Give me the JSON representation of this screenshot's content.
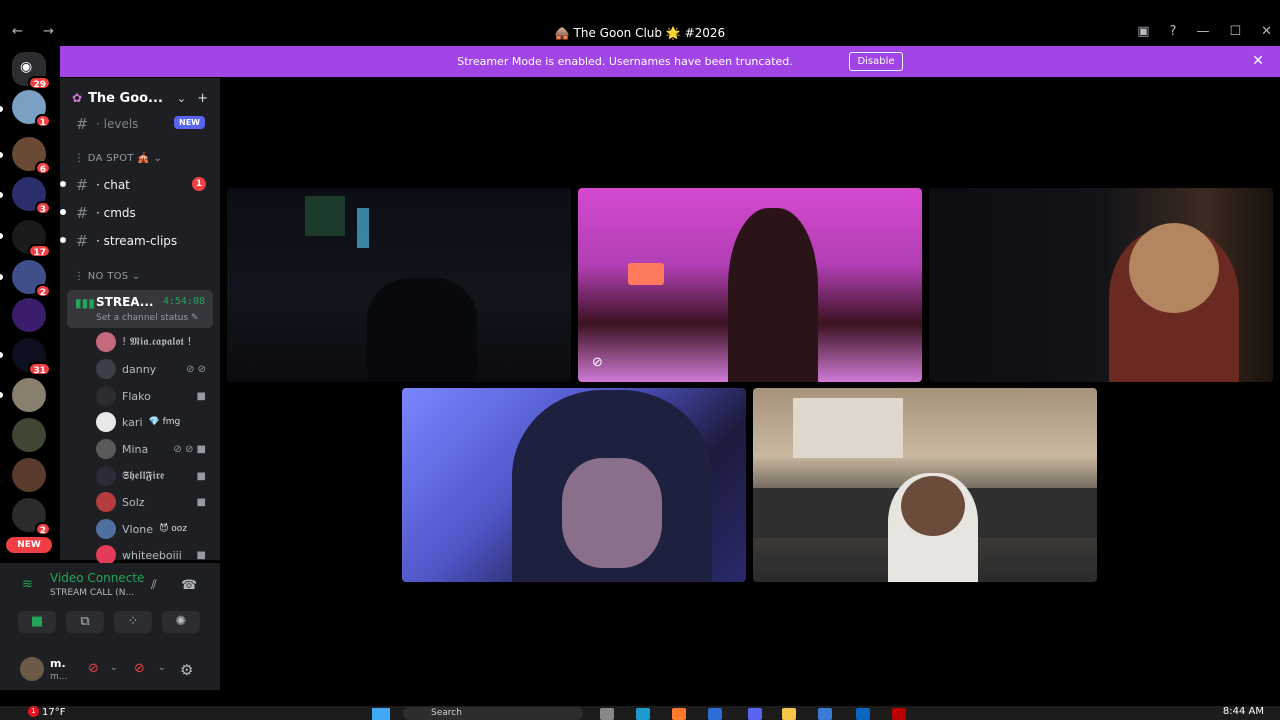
{
  "window": {
    "title": "🛖 The Goon Club 🌟 #2026",
    "nav_arrows": "← →",
    "controls": [
      "▣",
      "?",
      "—",
      "☐",
      "✕"
    ]
  },
  "banner": {
    "message": "Streamer Mode is enabled. Usernames have been truncated.",
    "button": "Disable",
    "close": "✕"
  },
  "rail": {
    "badges": [
      "29",
      "1",
      "6",
      "3",
      "17",
      "2",
      "31",
      "2"
    ],
    "new_label": "NEW"
  },
  "guild": {
    "name": "The Goo...",
    "chevron": "⌄",
    "add_icon": "+"
  },
  "channels": {
    "top": {
      "name": "· levels",
      "tag": "NEW"
    },
    "category1": "⋮ DA SPOT 🎪 ⌄",
    "chat": {
      "name": "· chat",
      "badge": "1"
    },
    "cmds": {
      "name": "· cmds"
    },
    "clips": {
      "name": "· stream-clips"
    },
    "category2": "⋮ NO TOS ⌄"
  },
  "voice_channel": {
    "name": "STREA...",
    "time": "4:54:08",
    "status": "Set a channel status ✎"
  },
  "members": [
    {
      "name": "! 𝕸𝖎𝖆.𝖈𝖆𝖕𝖆𝖑𝖔𝖙 !",
      "icons": "",
      "tag": ""
    },
    {
      "name": "danny",
      "icons": "⊘ ⊘",
      "tag": ""
    },
    {
      "name": "Flako",
      "icons": "■",
      "tag": ""
    },
    {
      "name": "kari",
      "icons": "",
      "tag": "💎 fmg"
    },
    {
      "name": "Mina",
      "icons": "⊘ ⊘ ■",
      "tag": ""
    },
    {
      "name": "𝕾𝖍𝖊𝖑𝖑𝕱𝖎𝖗𝖊",
      "icons": "■",
      "tag": ""
    },
    {
      "name": "Solz",
      "icons": "■",
      "tag": ""
    },
    {
      "name": "Vlone",
      "icons": "",
      "tag": "😈 ooz"
    },
    {
      "name": "whiteeboiii",
      "icons": "■",
      "tag": ""
    }
  ],
  "rtc": {
    "status": "Video Connecte",
    "channel": "STREAM CALL (N...",
    "buttons": [
      "■",
      "⧉",
      "⁘",
      "✺"
    ]
  },
  "user": {
    "name": "m.",
    "tag": "m...",
    "gear": "⚙"
  },
  "taskbar": {
    "weather": "17°F",
    "weather_badge": "1",
    "search": "Search",
    "clock": "8:44 AM"
  },
  "colors": {
    "banner": "#a145e6",
    "online": "#23a55a",
    "danger": "#f23f43",
    "sidebar": "#1e1f22"
  }
}
